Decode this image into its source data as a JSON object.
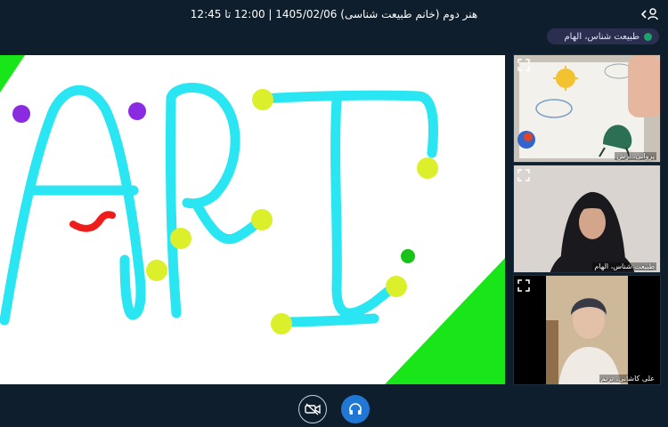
{
  "session": {
    "title": "هنر دوم (خانم طبیعت شناسی) 1405/02/06 | 12:00 تا 12:45",
    "toggle_icon": "chevron-left-user-icon"
  },
  "presenter": {
    "name": "طبیعت شناس، الهام",
    "status_color": "#1aa36b"
  },
  "whiteboard": {
    "drawn_text": "ARI",
    "stroke_color": "#29e6f2",
    "accent_colors": {
      "green": "#19e619",
      "purple": "#8a2be2",
      "yellow": "#dbf02a",
      "red": "#ef1c1c"
    }
  },
  "participants": [
    {
      "name": "پروانی، آرش",
      "icon": "expand-icon"
    },
    {
      "name": "طبیعت شناس، الهام",
      "icon": "expand-icon"
    },
    {
      "name": "علی کاشانی، ترنم",
      "icon": "expand-icon"
    }
  ],
  "controls": {
    "camera_icon": "camera-off-icon",
    "audio_icon": "headphones-icon",
    "audio_color": "#2178d4"
  }
}
